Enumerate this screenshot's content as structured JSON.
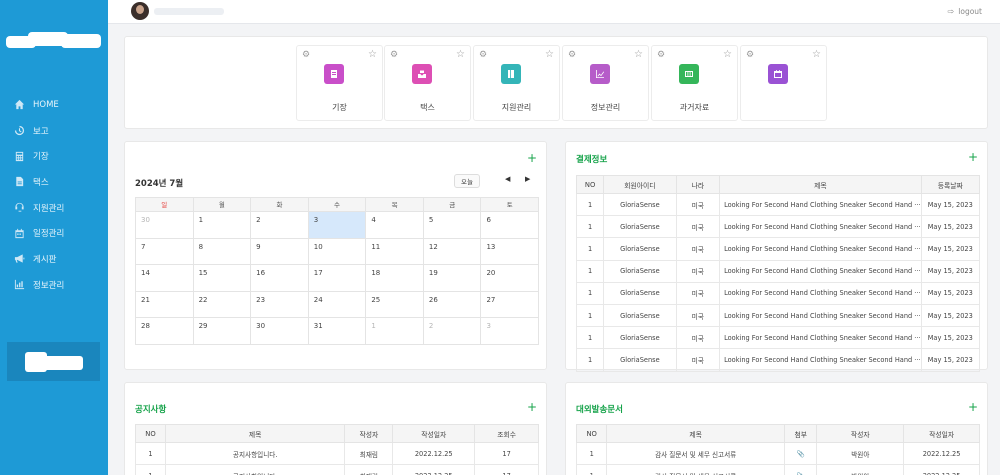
{
  "sidebar": {
    "items": [
      {
        "label": "HOME",
        "icon": "home-icon"
      },
      {
        "label": "보고",
        "icon": "history-icon"
      },
      {
        "label": "기장",
        "icon": "calculator-icon"
      },
      {
        "label": "택스",
        "icon": "file-icon"
      },
      {
        "label": "지원관리",
        "icon": "support-icon"
      },
      {
        "label": "일정관리",
        "icon": "calendar-icon"
      },
      {
        "label": "게시판",
        "icon": "megaphone-icon"
      },
      {
        "label": "정보관리",
        "icon": "chart-icon"
      }
    ]
  },
  "header": {
    "logout_label": "logout"
  },
  "quick_menu": [
    {
      "label": "기장",
      "color": "#c94fc9"
    },
    {
      "label": "택스",
      "color": "#dd4fb4"
    },
    {
      "label": "지원관리",
      "color": "#34b5b8"
    },
    {
      "label": "정보관리",
      "color": "#b65cc9"
    },
    {
      "label": "과거자료",
      "color": "#35b65a"
    },
    {
      "label": "",
      "color": "#9a52d4"
    }
  ],
  "calendar": {
    "month_label": "2024년 7월",
    "today_label": "오늘",
    "prev": "◀",
    "next": "▶",
    "weekdays": [
      "일",
      "월",
      "화",
      "수",
      "목",
      "금",
      "토"
    ],
    "weekday_colors": [
      "#e53935",
      "#555",
      "#555",
      "#555",
      "#555",
      "#555",
      "#555"
    ],
    "weeks": [
      [
        "30",
        "1",
        "2",
        "3",
        "4",
        "5",
        "6"
      ],
      [
        "7",
        "8",
        "9",
        "10",
        "11",
        "12",
        "13"
      ],
      [
        "14",
        "15",
        "16",
        "17",
        "18",
        "19",
        "20"
      ],
      [
        "21",
        "22",
        "23",
        "24",
        "25",
        "26",
        "27"
      ],
      [
        "28",
        "29",
        "30",
        "31",
        "1",
        "2",
        "3"
      ]
    ]
  },
  "payment": {
    "title": "결제정보",
    "plus": "+",
    "headers": [
      "NO",
      "회원아이디",
      "나라",
      "제목",
      "등록날짜"
    ],
    "rows": [
      [
        "1",
        "GloriaSense",
        "미국",
        "Looking For Second Hand Clothing Sneaker Second Hand ···",
        "May 15, 2023"
      ],
      [
        "1",
        "GloriaSense",
        "미국",
        "Looking For Second Hand Clothing Sneaker Second Hand ···",
        "May 15, 2023"
      ],
      [
        "1",
        "GloriaSense",
        "미국",
        "Looking For Second Hand Clothing Sneaker Second Hand ···",
        "May 15, 2023"
      ],
      [
        "1",
        "GloriaSense",
        "미국",
        "Looking For Second Hand Clothing Sneaker Second Hand ···",
        "May 15, 2023"
      ],
      [
        "1",
        "GloriaSense",
        "미국",
        "Looking For Second Hand Clothing Sneaker Second Hand ···",
        "May 15, 2023"
      ],
      [
        "1",
        "GloriaSense",
        "미국",
        "Looking For Second Hand Clothing Sneaker Second Hand ···",
        "May 15, 2023"
      ],
      [
        "1",
        "GloriaSense",
        "미국",
        "Looking For Second Hand Clothing Sneaker Second Hand ···",
        "May 15, 2023"
      ],
      [
        "1",
        "GloriaSense",
        "미국",
        "Looking For Second Hand Clothing Sneaker Second Hand ···",
        "May 15, 2023"
      ]
    ]
  },
  "notice": {
    "title": "공지사항",
    "plus": "+",
    "headers": [
      "NO",
      "제목",
      "작성자",
      "작성일자",
      "조회수"
    ],
    "rows": [
      [
        "1",
        "공지사항입니다.",
        "최재림",
        "2022.12.25",
        "17"
      ],
      [
        "1",
        "공지사항입니다.",
        "최재림",
        "2022.12.25",
        "17"
      ]
    ]
  },
  "external_docs": {
    "title": "대외발송문서",
    "plus": "+",
    "headers": [
      "NO",
      "제목",
      "첨부",
      "작성자",
      "작성일자"
    ],
    "rows": [
      [
        "1",
        "감사 질문서 및 세무 신고서류",
        "📎",
        "박원아",
        "2022.12.25"
      ],
      [
        "1",
        "감사 질문서 및 세무 신고서류",
        "📎",
        "박원아",
        "2022.12.25"
      ]
    ]
  }
}
